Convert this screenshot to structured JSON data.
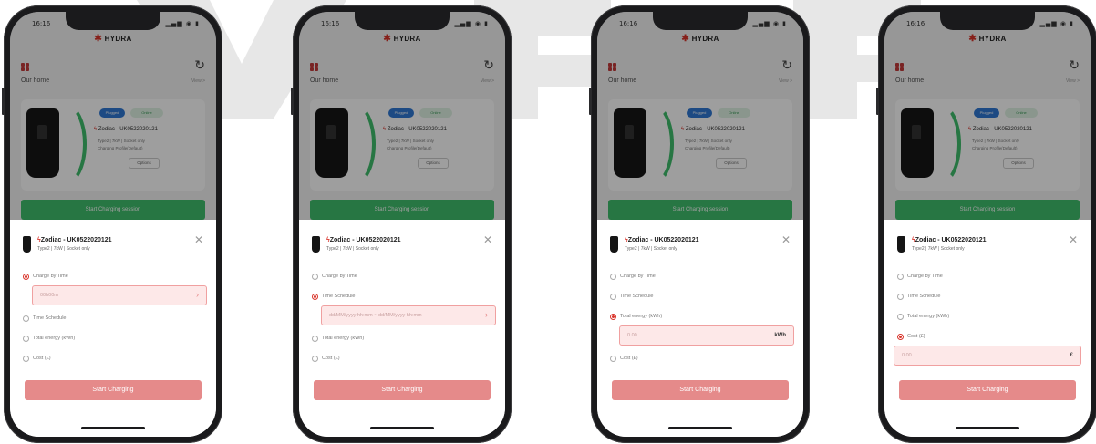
{
  "watermark_color": "#e7e7e7",
  "status_bar": {
    "time": "16:16",
    "icons": "▂▄▆ ◉ ▮"
  },
  "brand": {
    "name": "HYDRA"
  },
  "home": {
    "title": "Our home",
    "more": "View >"
  },
  "charger": {
    "name": "Zodiac - UK0522020121",
    "status_plugged": "Plugged",
    "status_online": "Online",
    "meta_line1": "Type2 | 7kW | Socket only",
    "meta_line2": "Charging Profile(Default)",
    "options_label": "Options"
  },
  "start_bar_label": "Start Charging session",
  "sheet": {
    "title": "Zodiac - UK0522020121",
    "subtitle": "Type2 | 7kW | Socket only",
    "close_icon": "close-icon"
  },
  "options": {
    "time": "Charge by Time",
    "schedule": "Time Schedule",
    "energy": "Total energy (kWh)",
    "cost": "Cost (£)"
  },
  "fields": {
    "time_placeholder": "00h00m",
    "schedule_placeholder": "dd/MM/yyyy hh:mm ~ dd/MM/yyyy hh:mm",
    "energy_placeholder": "0.00",
    "energy_unit": "kWh",
    "cost_placeholder": "0.00",
    "cost_unit": "£"
  },
  "start_button": "Start Charging",
  "colors": {
    "accent": "#d9342b",
    "button": "#e58a8a",
    "field_bg": "#fde8e8",
    "online": "#3fbf6c"
  }
}
